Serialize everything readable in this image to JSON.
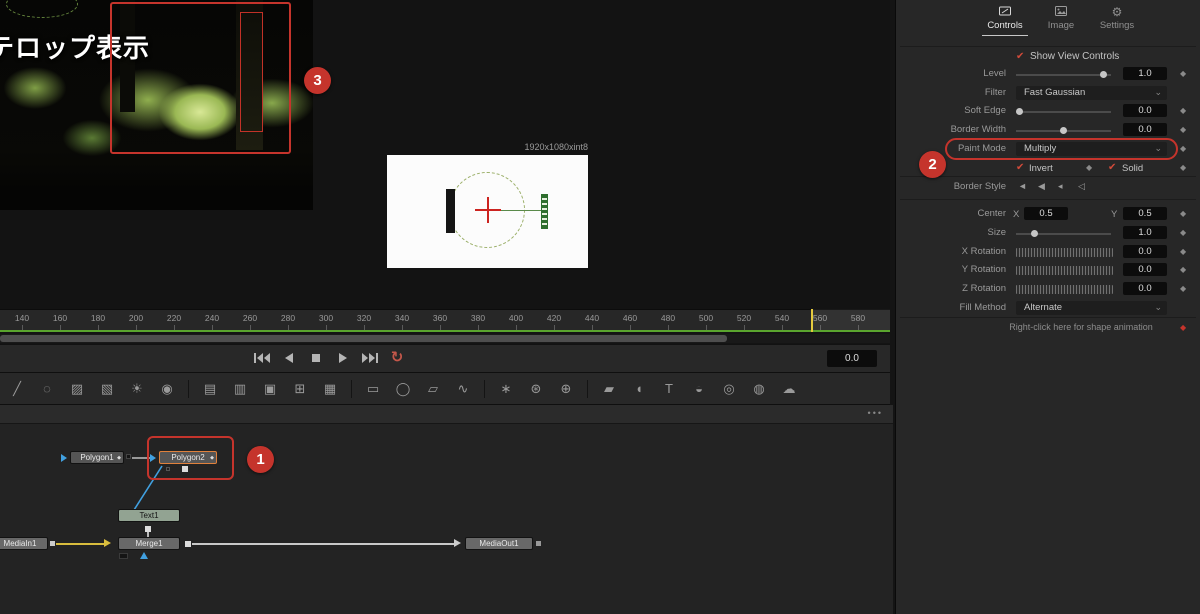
{
  "colors": {
    "accent_red": "#c5342c",
    "selection_orange": "#e0813c",
    "connection_blue": "#41a0e0",
    "connection_yellow": "#d9bd3e",
    "playhead_yellow": "#e5ca3e",
    "render_green": "#5aa52e",
    "check_red": "#d04a3a"
  },
  "icons": {
    "check": "✔",
    "chevron_down": "⌄",
    "diamond": "◆",
    "loop": "↻",
    "dots": "•••",
    "gear": "⚙"
  },
  "viewers": {
    "left_caption": "テロップ表示",
    "right_resolution": "1920x1080xint8"
  },
  "annotations": {
    "step1": "1",
    "step2": "2",
    "step3": "3"
  },
  "inspector": {
    "tabs": [
      {
        "label": "Controls"
      },
      {
        "label": "Image"
      },
      {
        "label": "Settings"
      }
    ],
    "show_view_controls": "Show View Controls",
    "rows": {
      "level": {
        "label": "Level",
        "value": "1.0"
      },
      "filter": {
        "label": "Filter",
        "value": "Fast Gaussian"
      },
      "soft_edge": {
        "label": "Soft Edge",
        "value": "0.0"
      },
      "border_width": {
        "label": "Border Width",
        "value": "0.0"
      },
      "paint_mode": {
        "label": "Paint Mode",
        "value": "Multiply"
      },
      "invert": {
        "label": "Invert"
      },
      "solid": {
        "label": "Solid"
      },
      "border_style": {
        "label": "Border Style"
      },
      "center": {
        "label": "Center",
        "x_label": "X",
        "x_value": "0.5",
        "y_label": "Y",
        "y_value": "0.5"
      },
      "size": {
        "label": "Size",
        "value": "1.0"
      },
      "x_rotation": {
        "label": "X Rotation",
        "value": "0.0"
      },
      "y_rotation": {
        "label": "Y Rotation",
        "value": "0.0"
      },
      "z_rotation": {
        "label": "Z Rotation",
        "value": "0.0"
      },
      "fill_method": {
        "label": "Fill Method",
        "value": "Alternate"
      }
    },
    "border_style_icons": [
      "◄",
      "◀",
      "◂",
      "◁"
    ],
    "footer_hint": "Right-click here for shape animation"
  },
  "timeline": {
    "ticks": [
      "140",
      "160",
      "180",
      "200",
      "220",
      "240",
      "260",
      "280",
      "300",
      "320",
      "340",
      "360",
      "380",
      "400",
      "420",
      "440",
      "460",
      "480",
      "500",
      "520",
      "540",
      "560",
      "580"
    ],
    "frame_display": "0.0"
  },
  "toolbar": {
    "tools": [
      {
        "name": "select-tool-icon",
        "glyph": "╱"
      },
      {
        "name": "fastnoise-tool-icon",
        "glyph": "◌"
      },
      {
        "name": "background-tool-icon",
        "glyph": "▨"
      },
      {
        "name": "gradient-tool-icon",
        "glyph": "▧"
      },
      {
        "name": "brightness-tool-icon",
        "glyph": "☀"
      },
      {
        "name": "blur-tool-icon",
        "glyph": "◉"
      },
      {
        "name": "loader-tool-icon",
        "glyph": "▤"
      },
      {
        "name": "saver-tool-icon",
        "glyph": "▥"
      },
      {
        "name": "merge-tool-icon",
        "glyph": "▣"
      },
      {
        "name": "resize-tool-icon",
        "glyph": "⊞"
      },
      {
        "name": "crop-tool-icon",
        "glyph": "▦"
      },
      {
        "name": "rectangle-mask-icon",
        "glyph": "▭"
      },
      {
        "name": "ellipse-mask-icon",
        "glyph": "◯"
      },
      {
        "name": "polygon-mask-icon",
        "glyph": "▱"
      },
      {
        "name": "bspline-mask-icon",
        "glyph": "∿"
      },
      {
        "name": "pemitter-tool-icon",
        "glyph": "∗"
      },
      {
        "name": "pmerge-tool-icon",
        "glyph": "⊛"
      },
      {
        "name": "prender-tool-icon",
        "glyph": "⊕"
      },
      {
        "name": "imageplane3d-tool-icon",
        "glyph": "▰"
      },
      {
        "name": "shape3d-tool-icon",
        "glyph": "◖"
      },
      {
        "name": "text3d-tool-icon",
        "glyph": "T"
      },
      {
        "name": "spotlight3d-tool-icon",
        "glyph": "◒"
      },
      {
        "name": "merge3d-tool-icon",
        "glyph": "◎"
      },
      {
        "name": "camera3d-tool-icon",
        "glyph": "◍"
      },
      {
        "name": "renderer3d-tool-icon",
        "glyph": "☁"
      }
    ]
  },
  "node_editor": {
    "nodes": {
      "mediain1": "MediaIn1",
      "merge1": "Merge1",
      "mediaout1": "MediaOut1",
      "text1": "Text1",
      "polygon1": "Polygon1",
      "polygon2": "Polygon2"
    }
  }
}
